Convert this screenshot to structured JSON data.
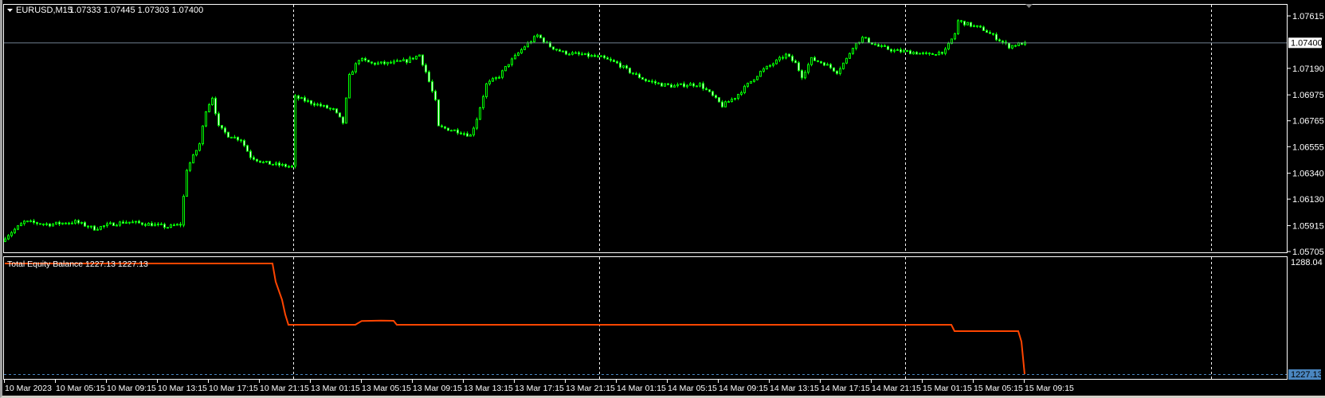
{
  "header": {
    "collapse_icon": "triangle-down-icon",
    "symbol": "EURUSD,M15",
    "ohlc": "1.07333 1.07445 1.07303 1.07400"
  },
  "indicator": {
    "label": "Total Equity Balance 1227.13 1227.13",
    "scale_top": "1288.04",
    "current_value": "1227.13"
  },
  "colors": {
    "background": "#000000",
    "candle_outline": "#00ff00",
    "bull_body": "#000000",
    "bear_body": "#ffffff",
    "equity_line": "#ff4500",
    "price_line": "#708090",
    "equity_level": "#4a86c0"
  },
  "chart_data": [
    {
      "type": "candlestick",
      "title": "EURUSD,M15",
      "current_price": 1.074,
      "current_price_label": "1.07400",
      "ylim": [
        1.05705,
        1.07615
      ],
      "y_ticks": [
        "1.07615",
        "1.07190",
        "1.06975",
        "1.06765",
        "1.06555",
        "1.06340",
        "1.06130",
        "1.05915",
        "1.05705"
      ],
      "x_ticks": [
        "10 Mar 2023",
        "10 Mar 05:15",
        "10 Mar 09:15",
        "10 Mar 13:15",
        "10 Mar 17:15",
        "10 Mar 21:15",
        "13 Mar 01:15",
        "13 Mar 05:15",
        "13 Mar 09:15",
        "13 Mar 13:15",
        "13 Mar 17:15",
        "13 Mar 21:15",
        "14 Mar 01:15",
        "14 Mar 05:15",
        "14 Mar 09:15",
        "14 Mar 13:15",
        "14 Mar 17:15",
        "14 Mar 21:15",
        "15 Mar 01:15",
        "15 Mar 05:15",
        "15 Mar 09:15"
      ],
      "day_separators_at_bar": [
        91,
        187,
        283,
        379
      ],
      "bar_count": 321,
      "close_path_bar_price": [
        [
          0,
          1.05822
        ],
        [
          6,
          1.05946
        ],
        [
          14,
          1.05925
        ],
        [
          22,
          1.05946
        ],
        [
          28,
          1.05891
        ],
        [
          33,
          1.05925
        ],
        [
          38,
          1.05946
        ],
        [
          46,
          1.05925
        ],
        [
          51,
          1.05904
        ],
        [
          55,
          1.05925
        ],
        [
          57,
          1.06372
        ],
        [
          61,
          1.06578
        ],
        [
          63,
          1.06852
        ],
        [
          65,
          1.06956
        ],
        [
          67,
          1.06715
        ],
        [
          70,
          1.06646
        ],
        [
          74,
          1.06612
        ],
        [
          77,
          1.06475
        ],
        [
          81,
          1.06426
        ],
        [
          86,
          1.06406
        ],
        [
          90,
          1.06392
        ],
        [
          91,
          1.06956
        ],
        [
          95,
          1.06921
        ],
        [
          99,
          1.06887
        ],
        [
          103,
          1.06852
        ],
        [
          106,
          1.06749
        ],
        [
          108,
          1.07127
        ],
        [
          111,
          1.07265
        ],
        [
          115,
          1.0723
        ],
        [
          120,
          1.0723
        ],
        [
          126,
          1.07251
        ],
        [
          130,
          1.07299
        ],
        [
          132,
          1.07162
        ],
        [
          135,
          1.06921
        ],
        [
          136,
          1.06715
        ],
        [
          142,
          1.06681
        ],
        [
          146,
          1.06646
        ],
        [
          148,
          1.06784
        ],
        [
          151,
          1.07059
        ],
        [
          155,
          1.07127
        ],
        [
          158,
          1.0723
        ],
        [
          163,
          1.07368
        ],
        [
          167,
          1.07457
        ],
        [
          171,
          1.07368
        ],
        [
          175,
          1.0732
        ],
        [
          181,
          1.07299
        ],
        [
          187,
          1.07278
        ],
        [
          192,
          1.0723
        ],
        [
          196,
          1.07162
        ],
        [
          201,
          1.07093
        ],
        [
          206,
          1.07059
        ],
        [
          210,
          1.07045
        ],
        [
          214,
          1.07059
        ],
        [
          218,
          1.07059
        ],
        [
          221,
          1.0699
        ],
        [
          225,
          1.06887
        ],
        [
          229,
          1.06956
        ],
        [
          233,
          1.07059
        ],
        [
          237,
          1.07162
        ],
        [
          241,
          1.0723
        ],
        [
          245,
          1.07299
        ],
        [
          248,
          1.0723
        ],
        [
          250,
          1.07127
        ],
        [
          253,
          1.07265
        ],
        [
          257,
          1.0723
        ],
        [
          261,
          1.07162
        ],
        [
          264,
          1.07265
        ],
        [
          266,
          1.07368
        ],
        [
          269,
          1.07436
        ],
        [
          274,
          1.07368
        ],
        [
          279,
          1.07333
        ],
        [
          285,
          1.0732
        ],
        [
          290,
          1.07299
        ],
        [
          295,
          1.07333
        ],
        [
          298,
          1.07471
        ],
        [
          299,
          1.07574
        ],
        [
          303,
          1.07539
        ],
        [
          307,
          1.07505
        ],
        [
          311,
          1.07436
        ],
        [
          315,
          1.07368
        ],
        [
          320,
          1.074
        ]
      ]
    },
    {
      "type": "line",
      "title": "Total Equity Balance",
      "ylim": [
        1227.13,
        1288.04
      ],
      "series": [
        {
          "name": "Total Equity Balance",
          "points_bar_value": [
            [
              0,
              1288.04
            ],
            [
              84,
              1288.04
            ],
            [
              85,
              1278
            ],
            [
              87,
              1268
            ],
            [
              88,
              1260
            ],
            [
              89,
              1254.3
            ],
            [
              110,
              1254.3
            ],
            [
              112,
              1256.4
            ],
            [
              118,
              1256.6
            ],
            [
              122,
              1256.5
            ],
            [
              123,
              1254.3
            ],
            [
              297,
              1254.3
            ],
            [
              298,
              1250.8
            ],
            [
              318,
              1250.8
            ],
            [
              319,
              1245
            ],
            [
              320,
              1227.13
            ]
          ]
        }
      ]
    }
  ]
}
